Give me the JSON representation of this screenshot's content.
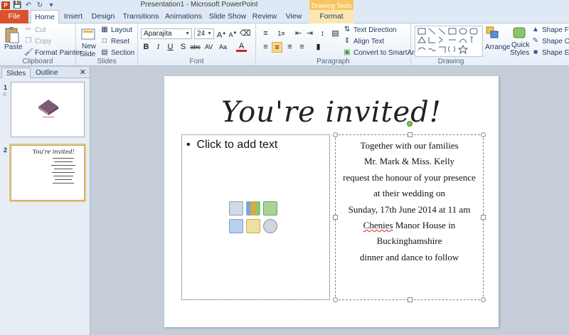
{
  "window": {
    "title": "Presentation1 - Microsoft PowerPoint",
    "context_tab": "Drawing Tools"
  },
  "tabs": [
    "File",
    "Home",
    "Insert",
    "Design",
    "Transitions",
    "Animations",
    "Slide Show",
    "Review",
    "View",
    "Format"
  ],
  "ribbon": {
    "clipboard": {
      "paste": "Paste",
      "cut": "Cut",
      "copy": "Copy",
      "format_painter": "Format Painter",
      "label": "Clipboard"
    },
    "slides": {
      "new_slide": "New",
      "new_slide2": "Slide",
      "layout": "Layout",
      "reset": "Reset",
      "section": "Section",
      "label": "Slides"
    },
    "font": {
      "font_name": "Aparajita",
      "font_size": "24",
      "label": "Font"
    },
    "paragraph": {
      "text_direction": "Text Direction",
      "align_text": "Align Text",
      "convert_smartart": "Convert to SmartArt",
      "label": "Paragraph"
    },
    "drawing": {
      "arrange": "Arrange",
      "quick_styles": "Quick",
      "quick_styles2": "Styles",
      "shape_fill": "Shape Fill",
      "shape_outline": "Shape Outl",
      "shape_effects": "Shape Effe",
      "label": "Drawing"
    }
  },
  "pane": {
    "tab_slides": "Slides",
    "tab_outline": "Outline",
    "slide_numbers": [
      "1",
      "2"
    ]
  },
  "slide": {
    "title": "You're invited!",
    "placeholder_text": "Click to add text",
    "lines": [
      "Together with our families",
      "Mr. Mark & Miss. Kelly",
      "request the honour of your presence",
      "at their wedding  on",
      "Sunday, 17th June 2014 at 11 am",
      "Chenies Manor House in",
      "Buckinghamshire",
      "dinner and dance to follow"
    ],
    "squiggle_word": "Chenies"
  },
  "colors": {
    "file_tab": "#d9532c",
    "context_tab": "#f7c65e",
    "selection": "#f5c45d"
  }
}
